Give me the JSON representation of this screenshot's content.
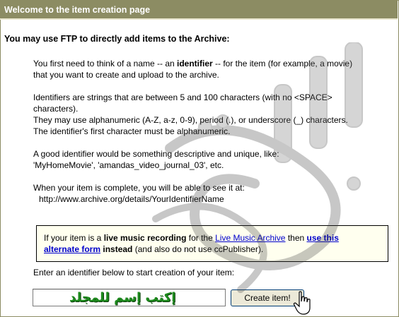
{
  "title": "Welcome to the item creation page",
  "heading": "You may use FTP to directly add items to the Archive:",
  "intro": {
    "before": "You first need to think of a name -- an ",
    "bold": "identifier",
    "after_line1": " -- for the item (for example, a movie)",
    "line2": "that you want to create and upload to the archive."
  },
  "rules": {
    "line1": "Identifiers are strings that are between 5 and 100 characters (with no <SPACE>",
    "line2": "characters).",
    "line3": "They may use alphanumeric (A-Z, a-z, 0-9), period (.), or underscore (_) characters.",
    "line4": "The identifier's first character must be alphanumeric."
  },
  "example": {
    "line1": "A good identifier would be something descriptive and unique, like:",
    "line2": "'MyHomeMovie', 'amandas_video_journal_03', etc."
  },
  "complete": {
    "line1": "When your item is complete, you will be able to see it at:",
    "url": "http://www.archive.org/details/YourIdentifierName"
  },
  "notice": {
    "part1": "If your item is a ",
    "bold1": "live music recording",
    "part2": " for the ",
    "link1": "Live Music Archive",
    "part3": " then ",
    "link2a": "use this",
    "link2b": "alternate form",
    "bold2": "instead",
    "part4": " (and also do not use ccPublisher)."
  },
  "enter_prompt": "Enter an identifier below to start creation of your item:",
  "identifier_input": {
    "value": "",
    "overlay_text": "إكتب إسم للمجلد"
  },
  "create_button": "Create item!",
  "colors": {
    "titlebar": "#8c8c63",
    "link": "#0000cc",
    "notice_bg": "#ffffef",
    "overlay_text": "#1d8a1d"
  },
  "icons": [
    "hand-cursor-icon"
  ]
}
